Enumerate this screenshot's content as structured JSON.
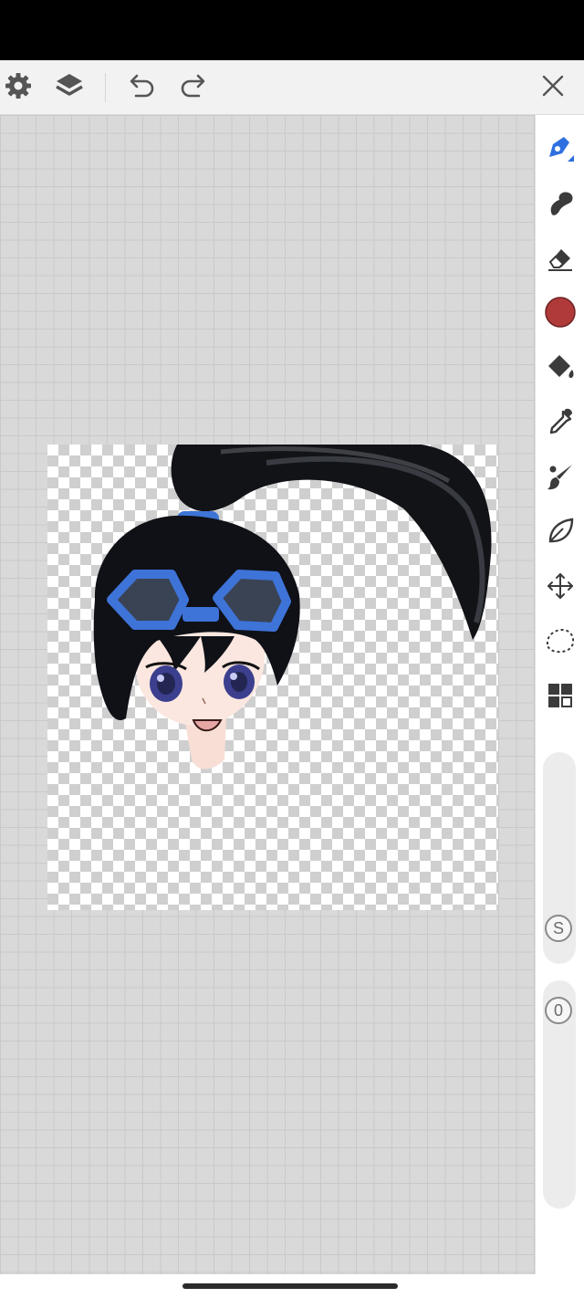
{
  "toolbar": {
    "settings_icon": "gear-icon",
    "layers_icon": "layers-icon",
    "undo_icon": "undo-icon",
    "redo_icon": "redo-icon",
    "close_icon": "close-icon"
  },
  "tools": [
    {
      "name": "pen",
      "icon": "pen-icon",
      "selected": true
    },
    {
      "name": "smudge",
      "icon": "smudge-icon"
    },
    {
      "name": "eraser",
      "icon": "eraser-icon"
    },
    {
      "name": "color",
      "icon": "color-swatch",
      "color": "#b03a3a"
    },
    {
      "name": "fill",
      "icon": "paint-bucket-icon"
    },
    {
      "name": "eyedropper",
      "icon": "eyedropper-icon"
    },
    {
      "name": "brush-settings",
      "icon": "brush-icon"
    },
    {
      "name": "leaf",
      "icon": "leaf-icon"
    },
    {
      "name": "transform",
      "icon": "move-arrows-icon"
    },
    {
      "name": "lasso",
      "icon": "lasso-icon"
    },
    {
      "name": "gallery",
      "icon": "grid-icon"
    }
  ],
  "size_slider": {
    "badge": "S"
  },
  "opacity_slider": {
    "badge": "0"
  },
  "colors": {
    "accent": "#2f6fe0",
    "current_color": "#b03a3a",
    "workspace_bg": "#d9d9d9"
  }
}
